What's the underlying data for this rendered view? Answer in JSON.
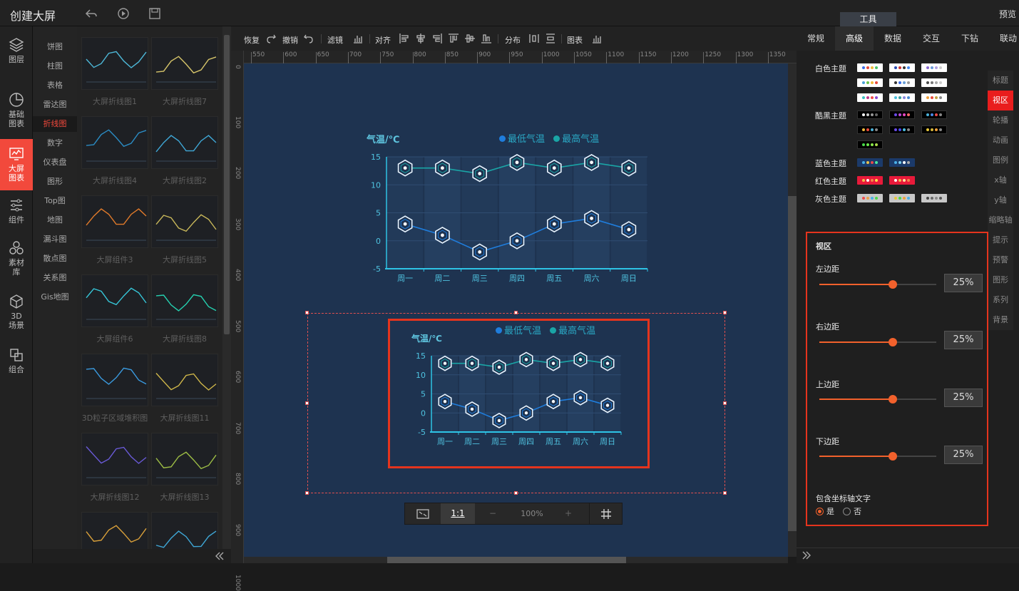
{
  "app": {
    "title": "创建大屏",
    "preview": "预览",
    "tools_tab": "工具"
  },
  "left_nav": [
    {
      "label": "图层",
      "icon": "layers-icon"
    },
    {
      "label": "基础图表",
      "icon": "pie-chart-icon"
    },
    {
      "label": "大屏图表",
      "icon": "screen-chart-icon"
    },
    {
      "label": "组件",
      "icon": "sliders-icon"
    },
    {
      "label": "素材库",
      "icon": "material-icon"
    },
    {
      "label": "3D场景",
      "icon": "cube-icon"
    },
    {
      "label": "组合",
      "icon": "group-icon"
    }
  ],
  "sub_nav": [
    "饼图",
    "柱图",
    "表格",
    "雷达图",
    "折线图",
    "数字",
    "仪表盘",
    "图形",
    "Top图",
    "地图",
    "漏斗图",
    "散点图",
    "关系图",
    "Gis地图"
  ],
  "sub_nav_active": "折线图",
  "thumbnails": [
    [
      "大屏折线图1",
      "大屏折线图7"
    ],
    [
      "大屏折线图4",
      "大屏折线图2"
    ],
    [
      "大屏组件3",
      "大屏折线图5"
    ],
    [
      "大屏组件6",
      "大屏折线图8"
    ],
    [
      "3D粒子区域堆积图",
      "大屏折线图11"
    ],
    [
      "大屏折线图12",
      "大屏折线图13"
    ],
    [
      "",
      ""
    ]
  ],
  "toolbar": {
    "redo": "恢复",
    "undo": "撤销",
    "filter": "滤镜",
    "align": "对齐",
    "distribute": "分布",
    "chart": "图表"
  },
  "ruler_ticks": [
    "550",
    "600",
    "650",
    "700",
    "750",
    "800",
    "850",
    "900",
    "950",
    "1000",
    "1050",
    "1100",
    "1150",
    "1200",
    "1250",
    "1300",
    "1350"
  ],
  "ruler_left": [
    "0",
    "100",
    "200",
    "300",
    "400",
    "500",
    "600",
    "700",
    "800",
    "900",
    "1000"
  ],
  "zoom": {
    "fit_label": "1:1",
    "minus": "−",
    "value": "100%",
    "plus": "+"
  },
  "right_tabs": [
    "常规",
    "高级",
    "数据",
    "交互",
    "下钻",
    "联动"
  ],
  "right_tab_active": "高级",
  "themes": [
    {
      "label": "白色主题"
    },
    {
      "label": "酷黑主题"
    },
    {
      "label": "蓝色主题"
    },
    {
      "label": "红色主题"
    },
    {
      "label": "灰色主题"
    }
  ],
  "side_tabs": [
    "标题",
    "视区",
    "轮播",
    "动画",
    "图例",
    "x轴",
    "y轴",
    "缩略轴",
    "提示",
    "预警",
    "图形",
    "系列",
    "背景"
  ],
  "side_tab_active": "视区",
  "viewbox": {
    "title": "视区",
    "left": {
      "label": "左边距",
      "value": "25%",
      "level": 0.63
    },
    "right": {
      "label": "右边距",
      "value": "25%",
      "level": 0.63
    },
    "top": {
      "label": "上边距",
      "value": "25%",
      "level": 0.63
    },
    "bottom": {
      "label": "下边距",
      "value": "25%",
      "level": 0.63
    },
    "axis_text_label": "包含坐标轴文字",
    "yes": "是",
    "no": "否",
    "selected": "是"
  },
  "chart_data": [
    {
      "type": "line",
      "ylabel": "气温/℃",
      "categories": [
        "周一",
        "周二",
        "周三",
        "周四",
        "周五",
        "周六",
        "周日"
      ],
      "ylim": [
        -5,
        15
      ],
      "yticks": [
        "15",
        "10",
        "5",
        "0",
        "-5"
      ],
      "series": [
        {
          "name": "最低气温",
          "values": [
            3,
            1,
            -2,
            0,
            3,
            4,
            2
          ],
          "color": "#1f7ddc"
        },
        {
          "name": "最高气温",
          "values": [
            13,
            13,
            12,
            14,
            13,
            14,
            13
          ],
          "color": "#1aa5a6"
        }
      ]
    },
    {
      "type": "line",
      "ylabel": "气温/℃",
      "categories": [
        "周一",
        "周二",
        "周三",
        "周四",
        "周五",
        "周六",
        "周日"
      ],
      "ylim": [
        -5,
        15
      ],
      "yticks": [
        "15",
        "10",
        "5",
        "0",
        "-5"
      ],
      "series": [
        {
          "name": "最低气温",
          "values": [
            3,
            1,
            -2,
            0,
            3,
            4,
            2
          ],
          "color": "#1f7ddc"
        },
        {
          "name": "最高气温",
          "values": [
            13,
            13,
            12,
            14,
            13,
            14,
            13
          ],
          "color": "#1aa5a6"
        }
      ]
    }
  ],
  "colors": {
    "accent": "#f2493c",
    "canvas": "#1e3350",
    "highlight_border": "#e5341d",
    "slider": "#f2612c"
  }
}
